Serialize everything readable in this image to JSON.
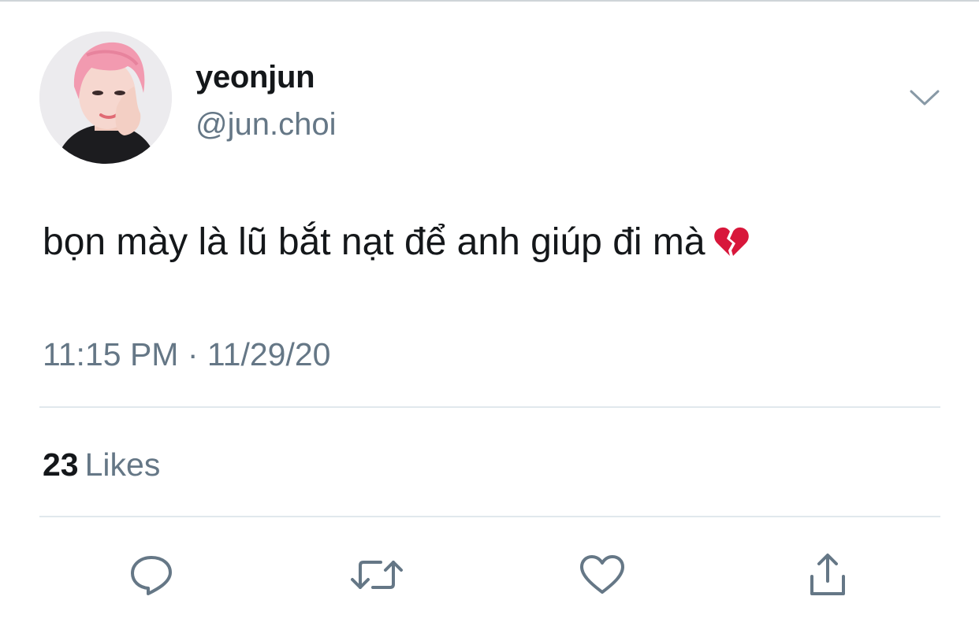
{
  "tweet": {
    "display_name": "yeonjun",
    "handle": "@jun.choi",
    "text": "bọn mày là lũ bắt nạt để anh giúp đi mà",
    "emoji_icon": "broken-heart-icon",
    "timestamp": "11:15 PM · 11/29/20",
    "likes_count": "23",
    "likes_label": "Likes"
  },
  "actions": [
    {
      "name": "reply",
      "icon": "reply-icon"
    },
    {
      "name": "retweet",
      "icon": "retweet-icon"
    },
    {
      "name": "like",
      "icon": "heart-icon"
    },
    {
      "name": "share",
      "icon": "share-icon"
    }
  ],
  "colors": {
    "text_primary": "#14171a",
    "text_secondary": "#657786",
    "divider": "#e1e8ed",
    "icon": "#657786",
    "emoji_red": "#e0245e",
    "avatar_hair": "#f29ab0"
  }
}
